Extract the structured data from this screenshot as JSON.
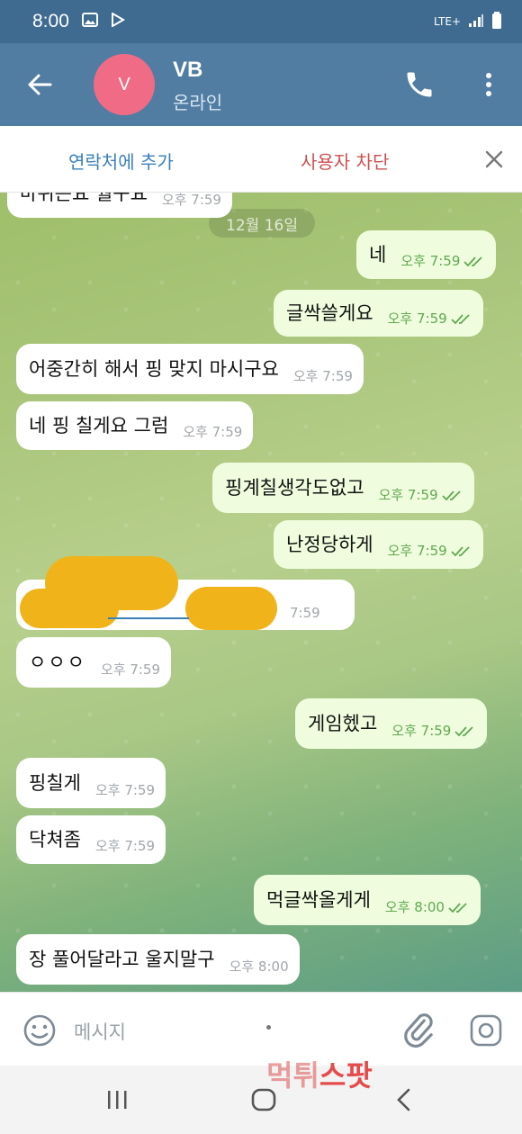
{
  "status_bar": {
    "time": "8:00",
    "network": "LTE+"
  },
  "header": {
    "avatar_letter": "V",
    "name": "VB",
    "status": "온라인"
  },
  "actions": {
    "add_contact": "연락처에 추가",
    "block_user": "사용자 차단"
  },
  "chat": {
    "date_label": "12월 16일",
    "messages": [
      {
        "dir": "in",
        "text": "마뉘는요 월구요",
        "time": "오후 7:59"
      },
      {
        "dir": "out",
        "text": "네",
        "time": "오후 7:59",
        "read": true
      },
      {
        "dir": "out",
        "text": "글싹쓸게요",
        "time": "오후 7:59",
        "read": true
      },
      {
        "dir": "in",
        "text": "어중간히 해서 핑 맞지 마시구요",
        "time": "오후 7:59"
      },
      {
        "dir": "in",
        "text": "네 핑 칠게요 그럼",
        "time": "오후 7:59"
      },
      {
        "dir": "out",
        "text": "핑계칠생각도없고",
        "time": "오후 7:59",
        "read": true
      },
      {
        "dir": "out",
        "text": "난정당하게",
        "time": "오후 7:59",
        "read": true
      },
      {
        "dir": "in",
        "text": "",
        "time": "7:59",
        "redacted": true
      },
      {
        "dir": "in",
        "text": "ㅇㅇㅇ",
        "time": "오후 7:59"
      },
      {
        "dir": "out",
        "text": "게임헸고",
        "time": "오후 7:59",
        "read": true
      },
      {
        "dir": "in",
        "text": "핑칠게",
        "time": "오후 7:59"
      },
      {
        "dir": "in",
        "text": "닥쳐좀",
        "time": "오후 7:59"
      },
      {
        "dir": "out",
        "text": "먹글싹올게게",
        "time": "오후 8:00",
        "read": true
      },
      {
        "dir": "in",
        "text": "장 풀어달라고 울지말구",
        "time": "오후 8:00"
      }
    ]
  },
  "input": {
    "placeholder": "메시지"
  },
  "watermark": {
    "part1": "먹튀",
    "part2": "스팟"
  },
  "colors": {
    "header": "#517da2",
    "status_bar": "#3f6b91",
    "avatar": "#ef6b86",
    "outgoing_bubble": "#effdde",
    "incoming_bubble": "#ffffff",
    "add_contact": "#3a7fb9",
    "block_user": "#cf4e4e"
  },
  "icons": [
    "back-arrow-icon",
    "phone-icon",
    "more-vert-icon",
    "close-icon",
    "emoji-icon",
    "attach-icon",
    "camera-icon",
    "read-ticks-icon"
  ]
}
